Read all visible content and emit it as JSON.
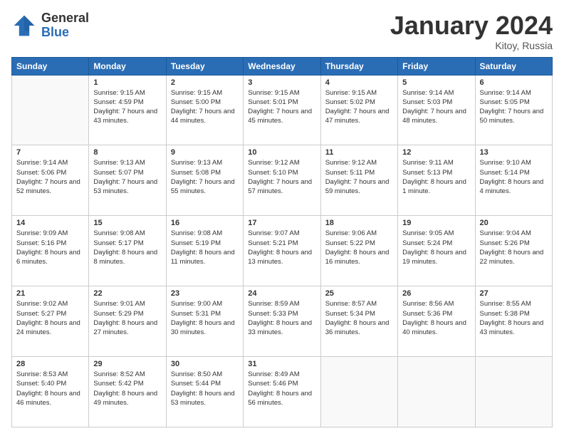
{
  "logo": {
    "general": "General",
    "blue": "Blue"
  },
  "header": {
    "month": "January 2024",
    "location": "Kitoy, Russia"
  },
  "weekdays": [
    "Sunday",
    "Monday",
    "Tuesday",
    "Wednesday",
    "Thursday",
    "Friday",
    "Saturday"
  ],
  "weeks": [
    [
      {
        "day": "",
        "sunrise": "",
        "sunset": "",
        "daylight": ""
      },
      {
        "day": "1",
        "sunrise": "Sunrise: 9:15 AM",
        "sunset": "Sunset: 4:59 PM",
        "daylight": "Daylight: 7 hours and 43 minutes."
      },
      {
        "day": "2",
        "sunrise": "Sunrise: 9:15 AM",
        "sunset": "Sunset: 5:00 PM",
        "daylight": "Daylight: 7 hours and 44 minutes."
      },
      {
        "day": "3",
        "sunrise": "Sunrise: 9:15 AM",
        "sunset": "Sunset: 5:01 PM",
        "daylight": "Daylight: 7 hours and 45 minutes."
      },
      {
        "day": "4",
        "sunrise": "Sunrise: 9:15 AM",
        "sunset": "Sunset: 5:02 PM",
        "daylight": "Daylight: 7 hours and 47 minutes."
      },
      {
        "day": "5",
        "sunrise": "Sunrise: 9:14 AM",
        "sunset": "Sunset: 5:03 PM",
        "daylight": "Daylight: 7 hours and 48 minutes."
      },
      {
        "day": "6",
        "sunrise": "Sunrise: 9:14 AM",
        "sunset": "Sunset: 5:05 PM",
        "daylight": "Daylight: 7 hours and 50 minutes."
      }
    ],
    [
      {
        "day": "7",
        "sunrise": "Sunrise: 9:14 AM",
        "sunset": "Sunset: 5:06 PM",
        "daylight": "Daylight: 7 hours and 52 minutes."
      },
      {
        "day": "8",
        "sunrise": "Sunrise: 9:13 AM",
        "sunset": "Sunset: 5:07 PM",
        "daylight": "Daylight: 7 hours and 53 minutes."
      },
      {
        "day": "9",
        "sunrise": "Sunrise: 9:13 AM",
        "sunset": "Sunset: 5:08 PM",
        "daylight": "Daylight: 7 hours and 55 minutes."
      },
      {
        "day": "10",
        "sunrise": "Sunrise: 9:12 AM",
        "sunset": "Sunset: 5:10 PM",
        "daylight": "Daylight: 7 hours and 57 minutes."
      },
      {
        "day": "11",
        "sunrise": "Sunrise: 9:12 AM",
        "sunset": "Sunset: 5:11 PM",
        "daylight": "Daylight: 7 hours and 59 minutes."
      },
      {
        "day": "12",
        "sunrise": "Sunrise: 9:11 AM",
        "sunset": "Sunset: 5:13 PM",
        "daylight": "Daylight: 8 hours and 1 minute."
      },
      {
        "day": "13",
        "sunrise": "Sunrise: 9:10 AM",
        "sunset": "Sunset: 5:14 PM",
        "daylight": "Daylight: 8 hours and 4 minutes."
      }
    ],
    [
      {
        "day": "14",
        "sunrise": "Sunrise: 9:09 AM",
        "sunset": "Sunset: 5:16 PM",
        "daylight": "Daylight: 8 hours and 6 minutes."
      },
      {
        "day": "15",
        "sunrise": "Sunrise: 9:08 AM",
        "sunset": "Sunset: 5:17 PM",
        "daylight": "Daylight: 8 hours and 8 minutes."
      },
      {
        "day": "16",
        "sunrise": "Sunrise: 9:08 AM",
        "sunset": "Sunset: 5:19 PM",
        "daylight": "Daylight: 8 hours and 11 minutes."
      },
      {
        "day": "17",
        "sunrise": "Sunrise: 9:07 AM",
        "sunset": "Sunset: 5:21 PM",
        "daylight": "Daylight: 8 hours and 13 minutes."
      },
      {
        "day": "18",
        "sunrise": "Sunrise: 9:06 AM",
        "sunset": "Sunset: 5:22 PM",
        "daylight": "Daylight: 8 hours and 16 minutes."
      },
      {
        "day": "19",
        "sunrise": "Sunrise: 9:05 AM",
        "sunset": "Sunset: 5:24 PM",
        "daylight": "Daylight: 8 hours and 19 minutes."
      },
      {
        "day": "20",
        "sunrise": "Sunrise: 9:04 AM",
        "sunset": "Sunset: 5:26 PM",
        "daylight": "Daylight: 8 hours and 22 minutes."
      }
    ],
    [
      {
        "day": "21",
        "sunrise": "Sunrise: 9:02 AM",
        "sunset": "Sunset: 5:27 PM",
        "daylight": "Daylight: 8 hours and 24 minutes."
      },
      {
        "day": "22",
        "sunrise": "Sunrise: 9:01 AM",
        "sunset": "Sunset: 5:29 PM",
        "daylight": "Daylight: 8 hours and 27 minutes."
      },
      {
        "day": "23",
        "sunrise": "Sunrise: 9:00 AM",
        "sunset": "Sunset: 5:31 PM",
        "daylight": "Daylight: 8 hours and 30 minutes."
      },
      {
        "day": "24",
        "sunrise": "Sunrise: 8:59 AM",
        "sunset": "Sunset: 5:33 PM",
        "daylight": "Daylight: 8 hours and 33 minutes."
      },
      {
        "day": "25",
        "sunrise": "Sunrise: 8:57 AM",
        "sunset": "Sunset: 5:34 PM",
        "daylight": "Daylight: 8 hours and 36 minutes."
      },
      {
        "day": "26",
        "sunrise": "Sunrise: 8:56 AM",
        "sunset": "Sunset: 5:36 PM",
        "daylight": "Daylight: 8 hours and 40 minutes."
      },
      {
        "day": "27",
        "sunrise": "Sunrise: 8:55 AM",
        "sunset": "Sunset: 5:38 PM",
        "daylight": "Daylight: 8 hours and 43 minutes."
      }
    ],
    [
      {
        "day": "28",
        "sunrise": "Sunrise: 8:53 AM",
        "sunset": "Sunset: 5:40 PM",
        "daylight": "Daylight: 8 hours and 46 minutes."
      },
      {
        "day": "29",
        "sunrise": "Sunrise: 8:52 AM",
        "sunset": "Sunset: 5:42 PM",
        "daylight": "Daylight: 8 hours and 49 minutes."
      },
      {
        "day": "30",
        "sunrise": "Sunrise: 8:50 AM",
        "sunset": "Sunset: 5:44 PM",
        "daylight": "Daylight: 8 hours and 53 minutes."
      },
      {
        "day": "31",
        "sunrise": "Sunrise: 8:49 AM",
        "sunset": "Sunset: 5:46 PM",
        "daylight": "Daylight: 8 hours and 56 minutes."
      },
      {
        "day": "",
        "sunrise": "",
        "sunset": "",
        "daylight": ""
      },
      {
        "day": "",
        "sunrise": "",
        "sunset": "",
        "daylight": ""
      },
      {
        "day": "",
        "sunrise": "",
        "sunset": "",
        "daylight": ""
      }
    ]
  ]
}
